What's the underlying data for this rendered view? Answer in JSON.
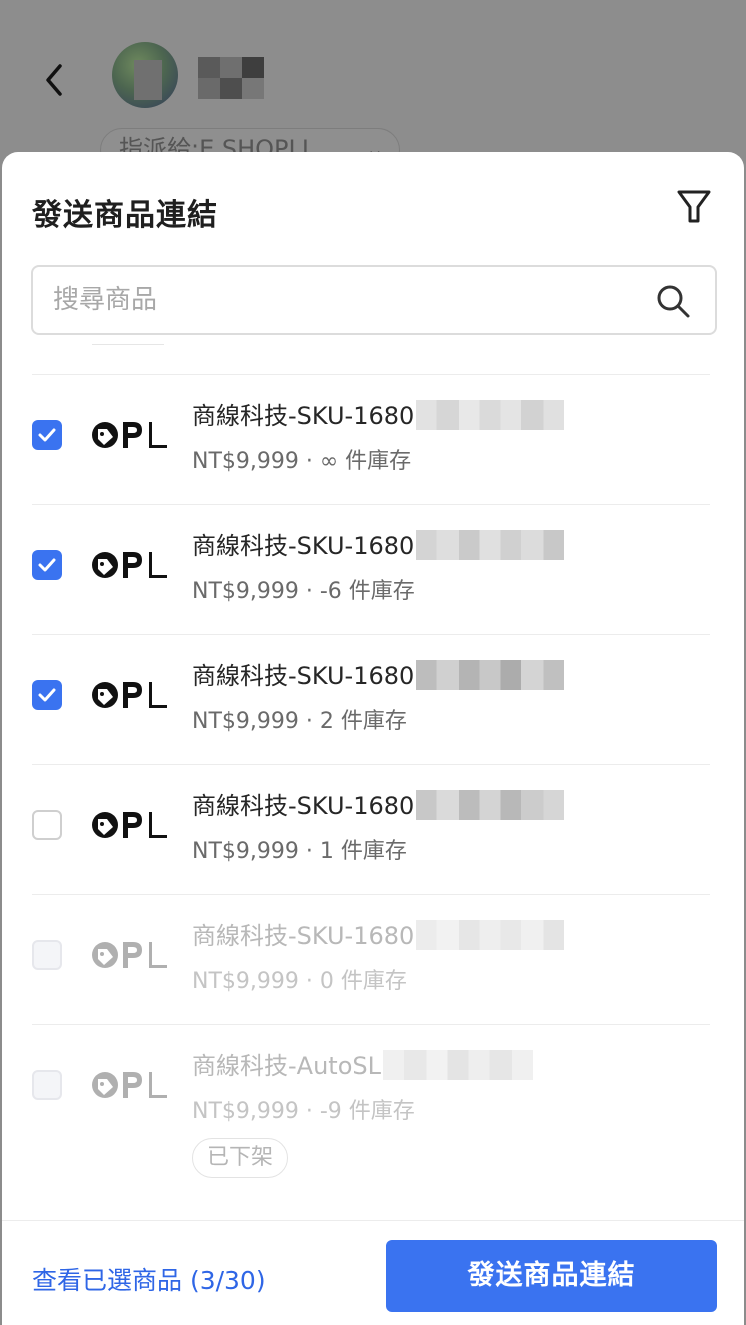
{
  "background": {
    "assign_label": "指派給:E SHOPLI",
    "avatar": "contact-avatar"
  },
  "sheet": {
    "title": "發送商品連結",
    "filter_icon": "filter-icon"
  },
  "search": {
    "placeholder": "搜尋商品",
    "value": "",
    "icon": "search-icon"
  },
  "products": [
    {
      "name": "商線科技-SKU-1680",
      "meta": "NT$9,999 · ∞ 件庫存",
      "checked": true,
      "disabled": false
    },
    {
      "name": "商線科技-SKU-1680",
      "meta": "NT$9,999 · -6 件庫存",
      "checked": true,
      "disabled": false
    },
    {
      "name": "商線科技-SKU-1680",
      "meta": "NT$9,999 · 2 件庫存",
      "checked": true,
      "disabled": false
    },
    {
      "name": "商線科技-SKU-1680",
      "meta": "NT$9,999 · 1 件庫存",
      "checked": false,
      "disabled": false
    },
    {
      "name": "商線科技-SKU-1680",
      "meta": "NT$9,999 · 0 件庫存",
      "checked": false,
      "disabled": true
    },
    {
      "name": "商線科技-AutoSL",
      "meta": "NT$9,999 · -9 件庫存",
      "checked": false,
      "disabled": true,
      "badge": "已下架"
    }
  ],
  "footer": {
    "view_selected_label": "查看已選商品 (3/30)",
    "send_label": "發送商品連結"
  },
  "colors": {
    "accent": "#3a73f0",
    "link": "#2f66e6",
    "overlay": "#8c8c8c"
  }
}
